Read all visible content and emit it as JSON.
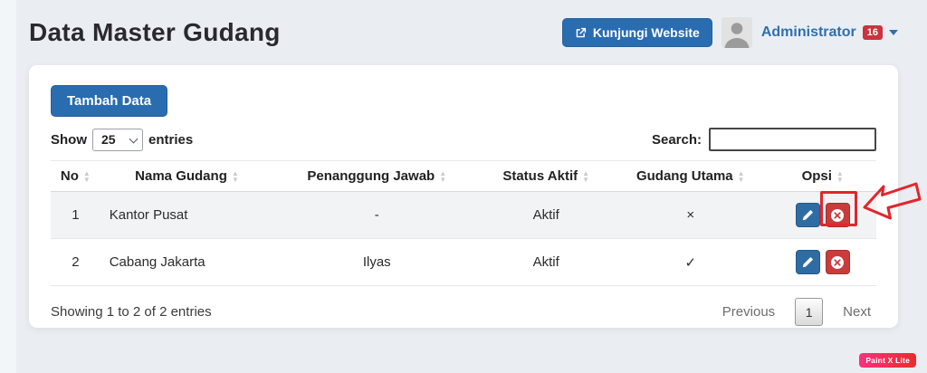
{
  "page": {
    "title": "Data Master Gudang"
  },
  "header": {
    "visit_button_label": "Kunjungi Website",
    "user_name": "Administrator",
    "notification_count": "16"
  },
  "toolbar": {
    "add_button_label": "Tambah Data",
    "show_label": "Show",
    "entries_label": "entries",
    "page_length": "25",
    "search_label": "Search:",
    "search_value": ""
  },
  "table": {
    "columns": [
      "No",
      "Nama Gudang",
      "Penanggung Jawab",
      "Status Aktif",
      "Gudang Utama",
      "Opsi"
    ],
    "rows": [
      {
        "no": "1",
        "nama_gudang": "Kantor Pusat",
        "penanggung_jawab": "-",
        "status_aktif": "Aktif",
        "gudang_utama": "×"
      },
      {
        "no": "2",
        "nama_gudang": "Cabang Jakarta",
        "penanggung_jawab": "Ilyas",
        "status_aktif": "Aktif",
        "gudang_utama": "✓"
      }
    ]
  },
  "pagination": {
    "info": "Showing 1 to 2 of 2 entries",
    "previous_label": "Previous",
    "current_page": "1",
    "next_label": "Next"
  },
  "watermark": "Paint X Lite",
  "colors": {
    "primary_blue": "#2a6cb0",
    "edit_blue": "#2e6da4",
    "danger_red": "#c83c3c",
    "badge_red": "#c9343f",
    "link_blue": "#2f6fae",
    "annotation_red": "#e2262c"
  }
}
